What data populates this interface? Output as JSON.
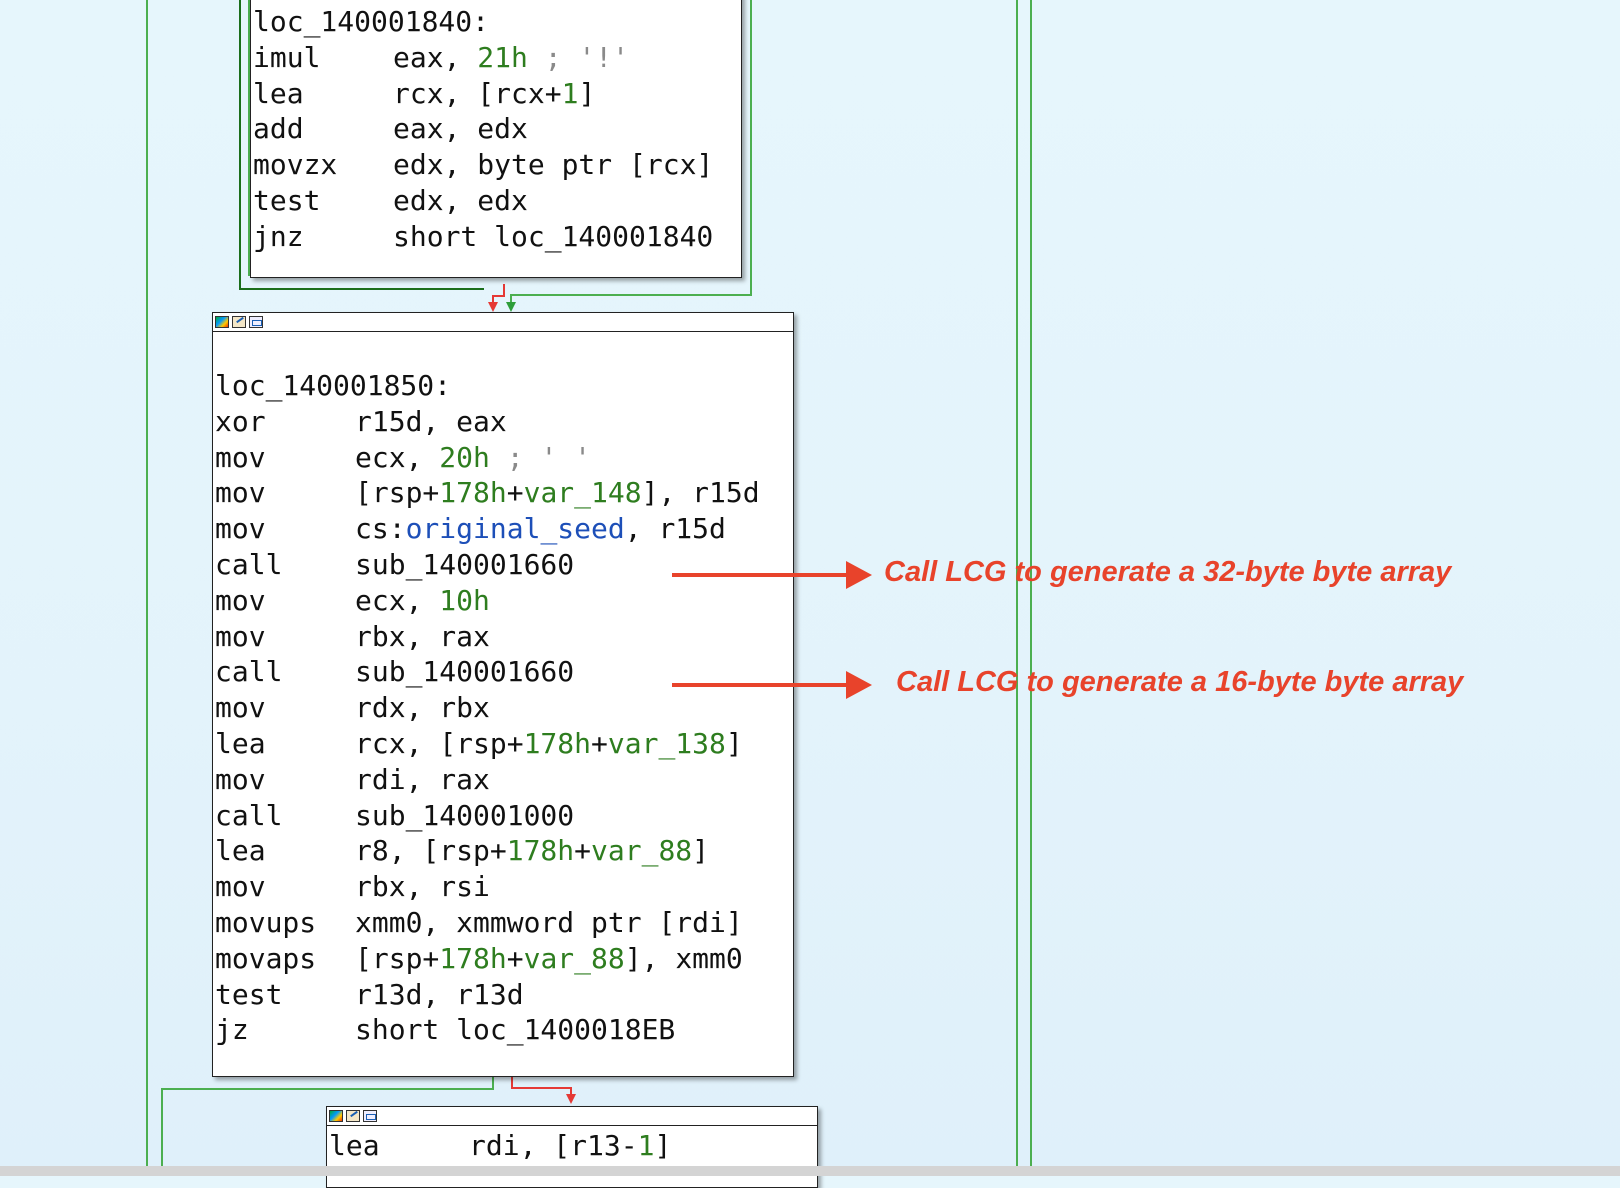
{
  "blocks": {
    "top": {
      "label": "loc_140001840:",
      "lines": [
        {
          "mn": "imul",
          "parts": [
            {
              "t": "eax, ",
              "c": "reg"
            },
            {
              "t": "21h",
              "c": "num"
            },
            {
              "t": " ; '!'",
              "c": "cmt"
            }
          ]
        },
        {
          "mn": "lea",
          "parts": [
            {
              "t": "rcx, [rcx+",
              "c": "reg"
            },
            {
              "t": "1",
              "c": "num"
            },
            {
              "t": "]",
              "c": "reg"
            }
          ]
        },
        {
          "mn": "add",
          "parts": [
            {
              "t": "eax, edx",
              "c": "reg"
            }
          ]
        },
        {
          "mn": "movzx",
          "parts": [
            {
              "t": "edx, byte ptr [rcx]",
              "c": "reg"
            }
          ]
        },
        {
          "mn": "test",
          "parts": [
            {
              "t": "edx, edx",
              "c": "reg"
            }
          ]
        },
        {
          "mn": "jnz",
          "parts": [
            {
              "t": "short loc_140001840",
              "c": "reg"
            }
          ]
        }
      ]
    },
    "middle": {
      "label": "loc_140001850:",
      "lines": [
        {
          "mn": "xor",
          "parts": [
            {
              "t": "r15d, eax",
              "c": "reg"
            }
          ]
        },
        {
          "mn": "mov",
          "parts": [
            {
              "t": "ecx, ",
              "c": "reg"
            },
            {
              "t": "20h",
              "c": "num"
            },
            {
              "t": " ; ' '",
              "c": "cmt"
            }
          ]
        },
        {
          "mn": "mov",
          "parts": [
            {
              "t": "[rsp+",
              "c": "reg"
            },
            {
              "t": "178h",
              "c": "num"
            },
            {
              "t": "+",
              "c": "reg"
            },
            {
              "t": "var_148",
              "c": "var"
            },
            {
              "t": "], r15d",
              "c": "reg"
            }
          ]
        },
        {
          "mn": "mov",
          "parts": [
            {
              "t": "cs:",
              "c": "reg"
            },
            {
              "t": "original_seed",
              "c": "sym"
            },
            {
              "t": ", r15d",
              "c": "reg"
            }
          ]
        },
        {
          "mn": "call",
          "parts": [
            {
              "t": "sub_140001660",
              "c": "reg"
            }
          ]
        },
        {
          "mn": "mov",
          "parts": [
            {
              "t": "ecx, ",
              "c": "reg"
            },
            {
              "t": "10h",
              "c": "num"
            }
          ]
        },
        {
          "mn": "mov",
          "parts": [
            {
              "t": "rbx, rax",
              "c": "reg"
            }
          ]
        },
        {
          "mn": "call",
          "parts": [
            {
              "t": "sub_140001660",
              "c": "reg"
            }
          ]
        },
        {
          "mn": "mov",
          "parts": [
            {
              "t": "rdx, rbx",
              "c": "reg"
            }
          ]
        },
        {
          "mn": "lea",
          "parts": [
            {
              "t": "rcx, [rsp+",
              "c": "reg"
            },
            {
              "t": "178h",
              "c": "num"
            },
            {
              "t": "+",
              "c": "reg"
            },
            {
              "t": "var_138",
              "c": "var"
            },
            {
              "t": "]",
              "c": "reg"
            }
          ]
        },
        {
          "mn": "mov",
          "parts": [
            {
              "t": "rdi, rax",
              "c": "reg"
            }
          ]
        },
        {
          "mn": "call",
          "parts": [
            {
              "t": "sub_140001000",
              "c": "reg"
            }
          ]
        },
        {
          "mn": "lea",
          "parts": [
            {
              "t": "r8, [rsp+",
              "c": "reg"
            },
            {
              "t": "178h",
              "c": "num"
            },
            {
              "t": "+",
              "c": "reg"
            },
            {
              "t": "var_88",
              "c": "var"
            },
            {
              "t": "]",
              "c": "reg"
            }
          ]
        },
        {
          "mn": "mov",
          "parts": [
            {
              "t": "rbx, rsi",
              "c": "reg"
            }
          ]
        },
        {
          "mn": "movups",
          "parts": [
            {
              "t": "xmm0, xmmword ptr [rdi]",
              "c": "reg"
            }
          ]
        },
        {
          "mn": "movaps",
          "parts": [
            {
              "t": "[rsp+",
              "c": "reg"
            },
            {
              "t": "178h",
              "c": "num"
            },
            {
              "t": "+",
              "c": "reg"
            },
            {
              "t": "var_88",
              "c": "var"
            },
            {
              "t": "], xmm0",
              "c": "reg"
            }
          ]
        },
        {
          "mn": "test",
          "parts": [
            {
              "t": "r13d, r13d",
              "c": "reg"
            }
          ]
        },
        {
          "mn": "jz",
          "parts": [
            {
              "t": "short loc_1400018EB",
              "c": "reg"
            }
          ]
        }
      ]
    },
    "bottom": {
      "lines": [
        {
          "mn": "lea",
          "parts": [
            {
              "t": "rdi, [r13-",
              "c": "reg"
            },
            {
              "t": "1",
              "c": "num"
            },
            {
              "t": "]",
              "c": "reg"
            }
          ]
        }
      ]
    }
  },
  "annotations": {
    "first": "Call LCG to generate a 32-byte byte array",
    "second": "Call LCG to generate a 16-byte byte array"
  },
  "colors": {
    "edge_green": "#4caf50",
    "edge_red": "#e53935",
    "annotation_red": "#e8432b",
    "number_green": "#2e7d1f",
    "symbol_blue": "#1d4fb8"
  }
}
